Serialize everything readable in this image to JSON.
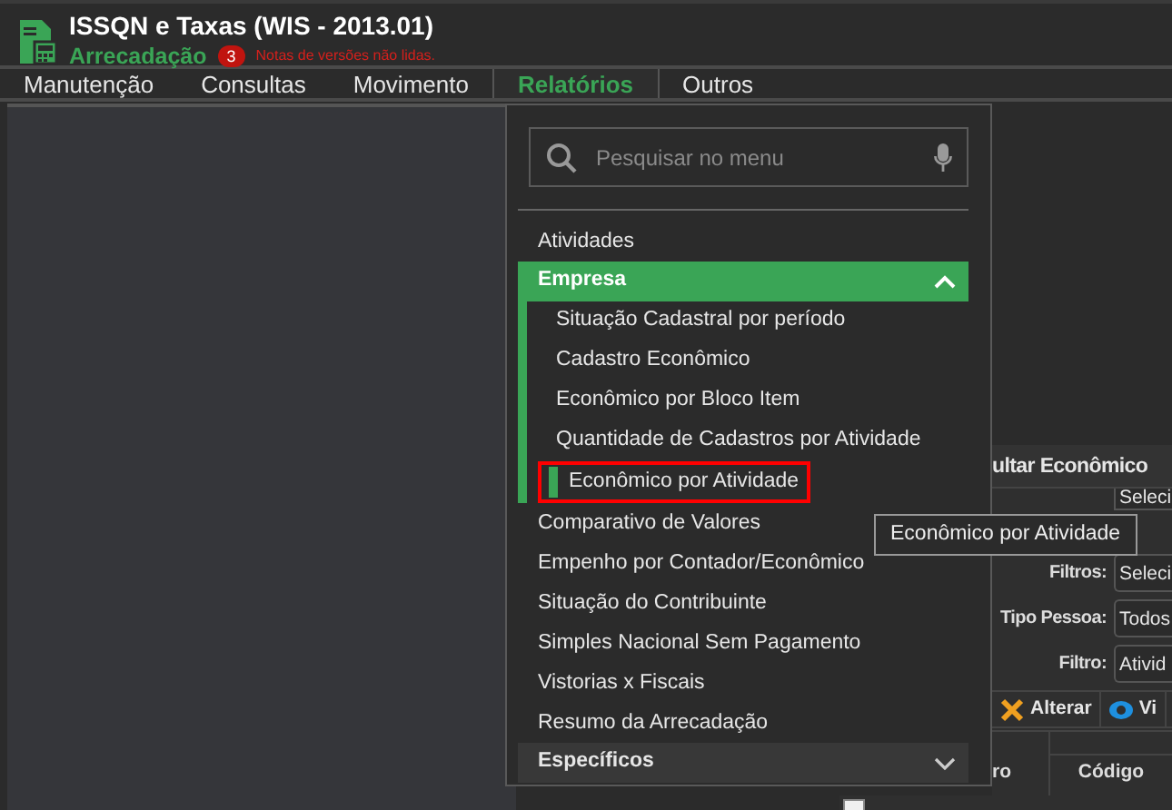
{
  "header": {
    "title": "ISSQN e Taxas (WIS - 2013.01)",
    "subtitle": "Arrecadação",
    "badge": "3",
    "notice": "Notas de versões não lidas."
  },
  "menubar": [
    {
      "label": "Manutenção",
      "selected": false
    },
    {
      "label": "Consultas",
      "selected": false
    },
    {
      "label": "Movimento",
      "selected": false
    },
    {
      "label": "Relatórios",
      "selected": true
    },
    {
      "label": "Outros",
      "selected": false
    }
  ],
  "menu": {
    "search": {
      "placeholder": "Pesquisar no menu"
    },
    "items": [
      {
        "kind": "item",
        "label": "Atividades"
      },
      {
        "kind": "group",
        "label": "Empresa",
        "expanded": true,
        "children": [
          {
            "label": "Situação Cadastral por período",
            "selected": false
          },
          {
            "label": "Cadastro Econômico",
            "selected": false
          },
          {
            "label": "Econômico por Bloco Item",
            "selected": false
          },
          {
            "label": "Quantidade de Cadastros por Atividade",
            "selected": false
          },
          {
            "label": "Econômico por Atividade",
            "selected": true
          }
        ]
      },
      {
        "kind": "item",
        "label": "Comparativo de Valores"
      },
      {
        "kind": "item",
        "label": "Empenho por Contador/Econômico"
      },
      {
        "kind": "item",
        "label": "Situação do Contribuinte"
      },
      {
        "kind": "item",
        "label": "Simples Nacional Sem Pagamento"
      },
      {
        "kind": "item",
        "label": "Vistorias x Fiscais"
      },
      {
        "kind": "item",
        "label": "Resumo da Arrecadação"
      },
      {
        "kind": "group",
        "label": "Específicos",
        "expanded": false
      }
    ]
  },
  "tooltip": "Econômico por Atividade",
  "form": {
    "title": "ultar Econômico",
    "fields": [
      {
        "value": "Seleci"
      },
      {
        "label": "Filtros:",
        "value": "Seleci"
      },
      {
        "label": "Tipo Pessoa:",
        "value": "Todos"
      },
      {
        "label": "Filtro:",
        "value": "Ativid"
      }
    ],
    "buttons": [
      {
        "kind": "edit",
        "label": "Alterar"
      },
      {
        "kind": "view",
        "label": "Vi"
      }
    ],
    "table": {
      "columns": [
        "ro",
        "Código"
      ],
      "rows": [
        {
          "checked": false
        }
      ]
    }
  }
}
